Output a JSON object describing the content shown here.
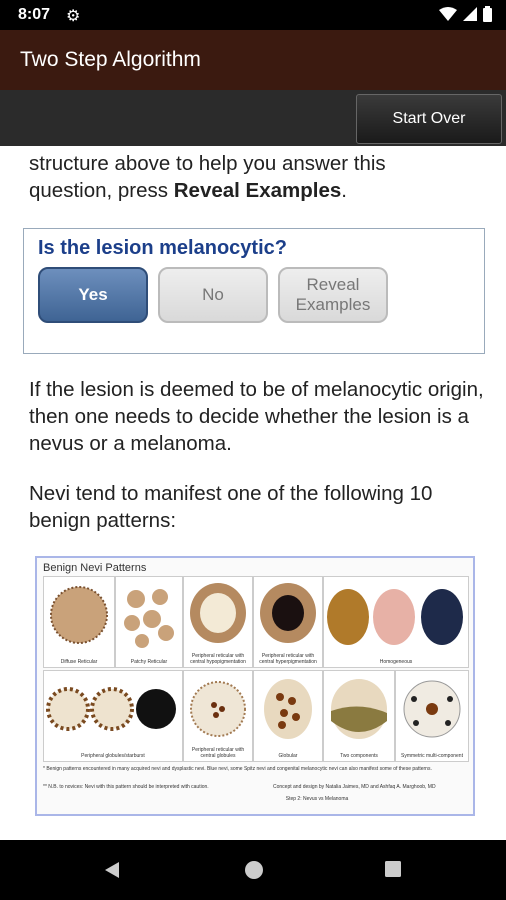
{
  "status": {
    "time": "8:07"
  },
  "app": {
    "title": "Two Step Algorithm",
    "start_over": "Start Over"
  },
  "intro": {
    "line1": "structure above to help you answer this",
    "line2_prefix": "question, press ",
    "line2_bold": "Reveal Examples",
    "line2_suffix": "."
  },
  "question": {
    "title": "Is the lesion melanocytic?",
    "yes": "Yes",
    "no": "No",
    "reveal_line1": "Reveal",
    "reveal_line2": "Examples"
  },
  "body": {
    "p1": "If the lesion is deemed to be of melanocytic origin, then one needs to decide whether the lesion is a nevus or a melanoma.",
    "p2": "Nevi tend to manifest one of the following 10 benign patterns:"
  },
  "figure": {
    "title": "Benign Nevi Patterns",
    "row1": [
      "Diffuse Reticular",
      "Patchy Reticular",
      "Peripheral reticular with central hypopigmentation",
      "Peripheral reticular with central hyperpigmentation",
      "Homogeneous"
    ],
    "row2": [
      "Peripheral globules/starburst",
      "Peripheral reticular with central globules",
      "Globular",
      "Two components",
      "Symmetric multi-component"
    ],
    "note1": "* Benign patterns encountered in many acquired nevi and dysplastic nevi. Blue nevi, some Spitz nevi and congenital melanocytic nevi can also manifest some of these patterns.",
    "note2": "** N.B. to novices: Nevi with this pattern should be interpreted with caution.",
    "credit": "Concept and design by Natalia Jaimes, MD and Ashfaq A. Marghoob, MD",
    "step": "Step 2: Nevus vs Melanoma"
  }
}
